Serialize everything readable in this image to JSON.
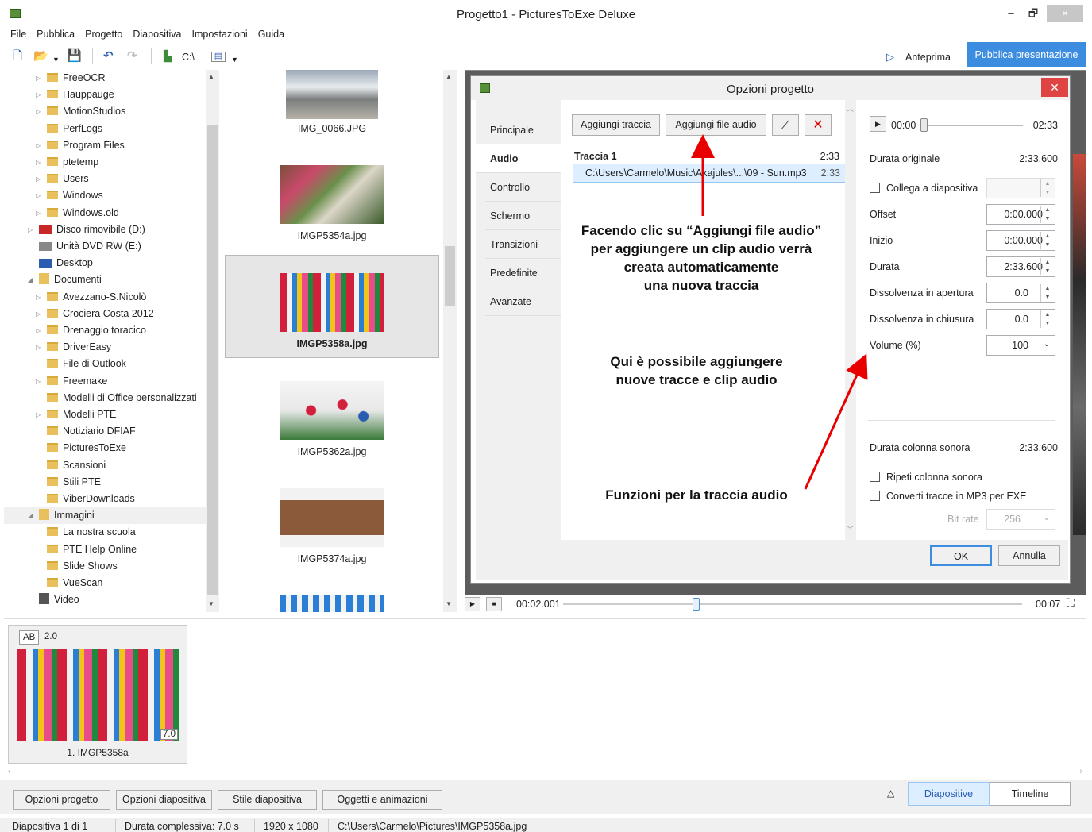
{
  "window": {
    "title": "Progetto1 - PicturesToExe Deluxe",
    "min_glyph": "–",
    "max_glyph": "🗗",
    "close_glyph": "×"
  },
  "menu": [
    "File",
    "Pubblica",
    "Progetto",
    "Diapositiva",
    "Impostazioni",
    "Guida"
  ],
  "toolbar": {
    "drive_label": "C:\\",
    "preview_label": "Anteprima",
    "publish_label": "Pubblica presentazione"
  },
  "tree": {
    "items": [
      {
        "label": "FreeOCR",
        "expandable": true,
        "level": 2
      },
      {
        "label": "Hauppauge",
        "expandable": true,
        "level": 2
      },
      {
        "label": "MotionStudios",
        "expandable": true,
        "level": 2
      },
      {
        "label": "PerfLogs",
        "expandable": false,
        "level": 2
      },
      {
        "label": "Program Files",
        "expandable": true,
        "level": 2
      },
      {
        "label": "ptetemp",
        "expandable": true,
        "level": 2
      },
      {
        "label": "Users",
        "expandable": true,
        "level": 2
      },
      {
        "label": "Windows",
        "expandable": true,
        "level": 2
      },
      {
        "label": "Windows.old",
        "expandable": true,
        "level": 2
      },
      {
        "label": "Disco rimovibile (D:)",
        "expandable": true,
        "level": 1,
        "icon": "removable-drive-icon"
      },
      {
        "label": "Unità DVD RW (E:)",
        "expandable": false,
        "level": 1,
        "icon": "dvd-drive-icon"
      },
      {
        "label": "Desktop",
        "expandable": false,
        "level": 1,
        "icon": "desktop-icon"
      },
      {
        "label": "Documenti",
        "expandable": true,
        "expanded": true,
        "level": 1,
        "icon": "documents-icon"
      },
      {
        "label": "Avezzano-S.Nicolò",
        "expandable": true,
        "level": 2
      },
      {
        "label": "Crociera Costa 2012",
        "expandable": true,
        "level": 2
      },
      {
        "label": "Drenaggio toracico",
        "expandable": true,
        "level": 2
      },
      {
        "label": "DriverEasy",
        "expandable": true,
        "level": 2
      },
      {
        "label": "File di Outlook",
        "expandable": false,
        "level": 2
      },
      {
        "label": "Freemake",
        "expandable": true,
        "level": 2
      },
      {
        "label": "Modelli di Office personalizzati",
        "expandable": false,
        "level": 2
      },
      {
        "label": "Modelli PTE",
        "expandable": true,
        "level": 2
      },
      {
        "label": "Notiziario DFIAF",
        "expandable": false,
        "level": 2
      },
      {
        "label": "PicturesToExe",
        "expandable": false,
        "level": 2
      },
      {
        "label": "Scansioni",
        "expandable": false,
        "level": 2
      },
      {
        "label": "Stili PTE",
        "expandable": false,
        "level": 2
      },
      {
        "label": "ViberDownloads",
        "expandable": false,
        "level": 2
      },
      {
        "label": "Immagini",
        "expandable": true,
        "expanded": true,
        "level": 1,
        "icon": "pictures-icon",
        "selected": true
      },
      {
        "label": "La nostra scuola",
        "expandable": false,
        "level": 2
      },
      {
        "label": "PTE Help Online",
        "expandable": false,
        "level": 2
      },
      {
        "label": "Slide Shows",
        "expandable": false,
        "level": 2
      },
      {
        "label": "VueScan",
        "expandable": false,
        "level": 2
      },
      {
        "label": "Video",
        "expandable": false,
        "level": 1,
        "icon": "videos-icon"
      }
    ]
  },
  "thumbnails": [
    {
      "name": "IMG_0066.JPG",
      "selected": false
    },
    {
      "name": "IMGP5354a.jpg",
      "selected": false
    },
    {
      "name": "IMGP5358a.jpg",
      "selected": true
    },
    {
      "name": "IMGP5362a.jpg",
      "selected": false
    },
    {
      "name": "IMGP5374a.jpg",
      "selected": false
    }
  ],
  "dialog": {
    "title": "Opzioni progetto",
    "tabs": [
      "Principale",
      "Audio",
      "Controllo",
      "Schermo",
      "Transizioni",
      "Predefinite",
      "Avanzate"
    ],
    "active_tab": "Audio",
    "add_track_label": "Aggiungi traccia",
    "add_audio_label": "Aggiungi file audio",
    "track": {
      "name": "Traccia 1",
      "duration": "2:33"
    },
    "clip": {
      "path": "C:\\Users\\Carmelo\\Music\\Akajules\\...\\09 - Sun.mp3",
      "duration": "2:33"
    },
    "annotations": {
      "a1": [
        "Facendo clic su “Aggiungi file audio”",
        "per aggiungere un clip audio verrà",
        "creata automaticamente",
        "una nuova traccia"
      ],
      "a2": [
        "Qui è possibile aggiungere",
        "nuove tracce e clip audio"
      ],
      "a3": [
        "Funzioni per la traccia audio"
      ]
    },
    "player": {
      "start": "00:00",
      "end": "02:33"
    },
    "props": {
      "durata_originale_label": "Durata originale",
      "durata_originale_value": "2:33.600",
      "collega_label": "Collega a diapositiva",
      "offset_label": "Offset",
      "offset_value": "0:00.000",
      "inizio_label": "Inizio",
      "inizio_value": "0:00.000",
      "durata_label": "Durata",
      "durata_value": "2:33.600",
      "fadein_label": "Dissolvenza in apertura",
      "fadein_value": "0.0",
      "fadeout_label": "Dissolvenza in chiusura",
      "fadeout_value": "0.0",
      "volume_label": "Volume (%)",
      "volume_value": "100",
      "soundtrack_label": "Durata colonna sonora",
      "soundtrack_value": "2:33.600",
      "repeat_label": "Ripeti colonna sonora",
      "convert_label": "Converti tracce in MP3 per EXE",
      "bitrate_label": "Bit rate",
      "bitrate_value": "256"
    },
    "ok_label": "OK",
    "cancel_label": "Annulla"
  },
  "playback": {
    "position": "00:02.001",
    "end": "00:07"
  },
  "slide": {
    "badge_ab": "AB",
    "badge_time": "2.0",
    "duration": "7.0",
    "label": "1. IMGP5358a"
  },
  "bottom": {
    "buttons": [
      "Opzioni progetto",
      "Opzioni diapositiva",
      "Stile diapositiva",
      "Oggetti e animazioni"
    ],
    "view_slides": "Diapositive",
    "view_timeline": "Timeline",
    "collapse_glyph": "△"
  },
  "status": {
    "slide": "Diapositiva 1 di 1",
    "total": "Durata complessiva: 7.0 s",
    "resolution": "1920 x 1080",
    "path": "C:\\Users\\Carmelo\\Pictures\\IMGP5358a.jpg"
  },
  "colors": {
    "accent": "#3c8ce0",
    "close_red": "#e04343",
    "arrow_red": "#e80000"
  }
}
